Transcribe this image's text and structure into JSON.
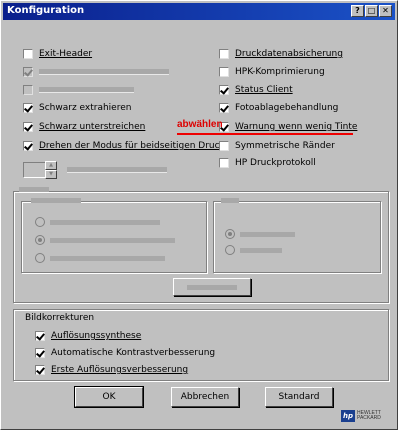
{
  "window": {
    "title": "Konfiguration"
  },
  "titlebar_buttons": [
    "?",
    "□",
    "✕"
  ],
  "left_options": [
    {
      "label": "Exit-Header",
      "checked": false,
      "enabled": true
    },
    {
      "label": "",
      "checked": true,
      "enabled": false
    },
    {
      "label": "",
      "checked": false,
      "enabled": false
    },
    {
      "label": "Schwarz extrahieren",
      "checked": true,
      "enabled": true
    },
    {
      "label": "Schwarz unterstreichen",
      "checked": true,
      "enabled": true
    },
    {
      "label": "Drehen der Modus für beidseitigen Druck",
      "checked": true,
      "enabled": true
    }
  ],
  "right_options": [
    {
      "label": "Druckdatenabsicherung",
      "checked": false,
      "enabled": true
    },
    {
      "label": "HPK-Komprimierung",
      "checked": false,
      "enabled": true
    },
    {
      "label": "Status Client",
      "checked": true,
      "enabled": true
    },
    {
      "label": "Fotoablagebehandlung",
      "checked": true,
      "enabled": true
    },
    {
      "label": "Warnung wenn wenig Tinte",
      "checked": true,
      "enabled": true
    },
    {
      "label": "Symmetrische Ränder",
      "checked": false,
      "enabled": true
    },
    {
      "label": "HP Druckprotokoll",
      "checked": false,
      "enabled": true
    }
  ],
  "annotation": {
    "text": "abwählen",
    "color": "#dd0000"
  },
  "disabled_group": {
    "radios_left": [
      "",
      "",
      ""
    ],
    "radios_right": [
      "",
      ""
    ],
    "button_label": ""
  },
  "image_correction": {
    "title": "Bildkorrekturen",
    "options": [
      {
        "label": "Auflösungssynthese",
        "checked": true
      },
      {
        "label": "Automatische Kontrastverbesserung",
        "checked": true
      },
      {
        "label": "Erste Auflösungsverbesserung",
        "checked": true
      }
    ]
  },
  "buttons": {
    "ok": "OK",
    "cancel": "Abbrechen",
    "default": "Standard"
  },
  "logo": {
    "badge": "hp",
    "line1": "HEWLETT",
    "line2": "PACKARD"
  }
}
